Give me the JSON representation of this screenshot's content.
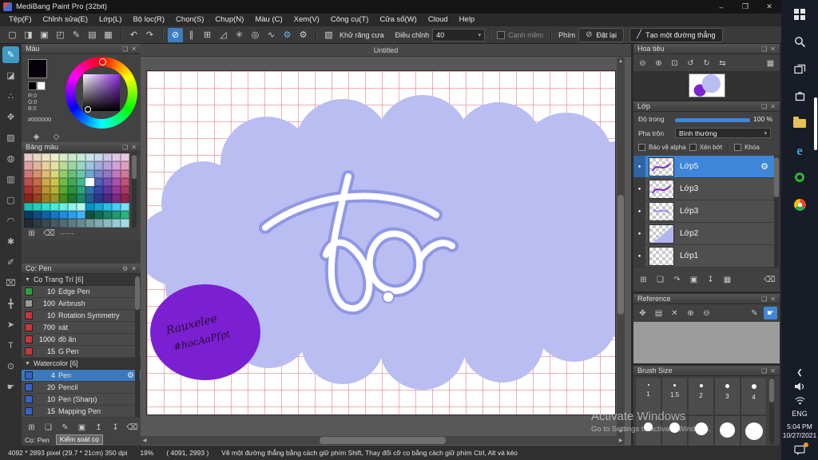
{
  "titlebar": {
    "title": "MediBang Paint Pro (32bit)",
    "minimize": "–",
    "maximize": "❐",
    "close": "✕"
  },
  "icons": {
    "float": "❏",
    "close": "✕",
    "caret": "▾",
    "group_arrow": "▼",
    "eye_dot": "●",
    "gear": "⚙",
    "scroll_up": "▲",
    "scroll_down": "▼",
    "scroll_left": "◀",
    "scroll_right": "▶",
    "chevron": "❮"
  },
  "menu": {
    "items": [
      "Tệp(F)",
      "Chỉnh sửa(E)",
      "Lớp(L)",
      "Bộ lọc(R)",
      "Chọn(S)",
      "Chụp(N)",
      "Màu (C)",
      "Xem(V)",
      "Công cụ(T)",
      "Cửa sổ(W)",
      "Cloud",
      "Help"
    ]
  },
  "toolbar": {
    "file_icons": [
      {
        "name": "new-canvas-icon",
        "glyph": "▢"
      },
      {
        "name": "open-file-icon",
        "glyph": "◨"
      },
      {
        "name": "save-icon",
        "glyph": "▣"
      },
      {
        "name": "comment-icon",
        "glyph": "◰"
      },
      {
        "name": "publish-icon",
        "glyph": "✎"
      },
      {
        "name": "pages-icon",
        "glyph": "▤"
      },
      {
        "name": "material-panel-icon",
        "glyph": "▦"
      }
    ],
    "history_icons": [
      {
        "name": "undo-icon",
        "glyph": "↶"
      },
      {
        "name": "redo-icon",
        "glyph": "↷"
      }
    ],
    "snap_icons": [
      {
        "name": "snap-off-icon",
        "glyph": "⊘",
        "active": true
      },
      {
        "name": "snap-parallel-icon",
        "glyph": "∥"
      },
      {
        "name": "snap-cross-icon",
        "glyph": "⊞"
      },
      {
        "name": "snap-vanishing-icon",
        "glyph": "◿"
      },
      {
        "name": "snap-radial-icon",
        "glyph": "✳"
      },
      {
        "name": "snap-ellipse-icon",
        "glyph": "◎"
      },
      {
        "name": "snap-curve-icon",
        "glyph": "∿"
      },
      {
        "name": "snap-settings-gear-icon",
        "glyph": "⚙",
        "accent": true
      },
      {
        "name": "settings-gear-icon",
        "glyph": "⚙"
      }
    ],
    "antialias_icon": "▧",
    "antialias_label": "Khử răng cưa",
    "adjust_label": "Điều chỉnh",
    "adjust_value": "40",
    "soft_label": "Cạnh mềm",
    "key_label": "Phím",
    "reset_icon": "⊘",
    "reset_label": "Đặt lại",
    "line_icon": "╱",
    "line_label": "Tạo một đường thẳng"
  },
  "toolstrip": {
    "tools": [
      {
        "name": "brush-tool",
        "glyph": "✎",
        "active": true
      },
      {
        "name": "eraser-tool",
        "glyph": "◪"
      },
      {
        "name": "dot-pen-tool",
        "glyph": "∴"
      },
      {
        "name": "move-tool",
        "glyph": "✥"
      },
      {
        "name": "fill-tool",
        "glyph": "▨"
      },
      {
        "name": "bucket-tool",
        "glyph": "◍"
      },
      {
        "name": "gradient-tool",
        "glyph": "▥"
      },
      {
        "name": "select-rect-tool",
        "glyph": "▢"
      },
      {
        "name": "lasso-tool",
        "glyph": "◠"
      },
      {
        "name": "magic-wand-tool",
        "glyph": "✱"
      },
      {
        "name": "select-pen-tool",
        "glyph": "✐"
      },
      {
        "name": "select-eraser-tool",
        "glyph": "⌧"
      },
      {
        "name": "divide-tool",
        "glyph": "╋"
      },
      {
        "name": "operation-tool",
        "glyph": "➤"
      },
      {
        "name": "text-tool",
        "glyph": "T"
      },
      {
        "name": "eyedropper-tool",
        "glyph": "⊙"
      },
      {
        "name": "hand-tool",
        "glyph": "☛"
      }
    ]
  },
  "color_panel": {
    "title": "Màu",
    "r": "R:0",
    "g": "G:0",
    "b": "B:0",
    "hex": "#000000",
    "dropper_icons": [
      {
        "name": "pick-color-icon",
        "glyph": "◈"
      },
      {
        "name": "add-to-palette-icon",
        "glyph": "◇"
      }
    ]
  },
  "palette_panel": {
    "title": "Bảng màu",
    "dashes": "-----",
    "selected": [
      3,
      7
    ],
    "footer_icons": [
      {
        "name": "add-color-icon",
        "glyph": "⊞"
      },
      {
        "name": "delete-color-icon",
        "glyph": "⌫"
      }
    ],
    "rows": [
      [
        "#e8c8c8",
        "#ecd6c6",
        "#f0e4c8",
        "#eef0cc",
        "#d8ecc6",
        "#c8e8cc",
        "#c6ead8",
        "#c8e6ea",
        "#c8d8ec",
        "#ccc8ec",
        "#e0c8ea",
        "#eac8dc"
      ],
      [
        "#dca0a0",
        "#e2b49a",
        "#e8d09e",
        "#e4e0a2",
        "#b8dc9a",
        "#9cd4a4",
        "#9ad8c4",
        "#9cc8e0",
        "#a0acde",
        "#b8a0dc",
        "#d4a0d8",
        "#e0a0bc"
      ],
      [
        "#cc7878",
        "#d49070",
        "#dcbc74",
        "#d8d478",
        "#94cc70",
        "#6cbc7c",
        "#6cc8a8",
        "#70a8d0",
        "#7884cc",
        "#9478c4",
        "#c078bc",
        "#d07898"
      ],
      [
        "#bc5050",
        "#c66c48",
        "#d0a84c",
        "#ccc450",
        "#70bc48",
        "#44a858",
        "#44b890",
        "#ffffff",
        "#5060bc",
        "#7850b4",
        "#ac50ac",
        "#c05078"
      ],
      [
        "#a83434",
        "#b25430",
        "#bc9434",
        "#b8b038",
        "#58a830",
        "#2c9440",
        "#2ca47c",
        "#3074ac",
        "#3848a8",
        "#60389c",
        "#983898",
        "#ac3864"
      ],
      [
        "#8c2222",
        "#964420",
        "#a07c24",
        "#9c9428",
        "#448c20",
        "#1c7830",
        "#1c8868",
        "#245c90",
        "#2c3890",
        "#4c2884",
        "#7c2880",
        "#902450"
      ],
      [
        "#18c0b0",
        "#20d0c0",
        "#30e0d0",
        "#48ecd8",
        "#68f0e0",
        "#90f4e8",
        "#b8f8f0",
        "#0890c8",
        "#18a8d8",
        "#28c0e8",
        "#48d0f0",
        "#78e0f8"
      ],
      [
        "#0a3a62",
        "#0e4e82",
        "#1262a2",
        "#1876c2",
        "#228ada",
        "#2e9eea",
        "#42b2f2",
        "#0e5242",
        "#126a52",
        "#1a8262",
        "#229a72",
        "#2ab282"
      ],
      [
        "#222a32",
        "#2e3a42",
        "#3a4a52",
        "#465a62",
        "#526a72",
        "#5e7a82",
        "#6a8a92",
        "#769aa2",
        "#82aab2",
        "#8ebac2",
        "#9acad2",
        "#a6dae2"
      ]
    ]
  },
  "brush_panel": {
    "title": "Cọ: Pen",
    "footer_label": "Cọ: Pen",
    "tooltip": "Kiểm soát cọ",
    "rows": [
      {
        "type": "group",
        "label": "Cọ Trang Trí [6]"
      },
      {
        "type": "brush",
        "size": "10",
        "name": "Edge Pen",
        "chip": "#2e9e40"
      },
      {
        "type": "brush",
        "size": "100",
        "name": "Airbrush",
        "chip": "#9a9a9a"
      },
      {
        "type": "brush",
        "size": "10",
        "name": "Rotation Symmetry",
        "chip": "#c23a3a"
      },
      {
        "type": "brush",
        "size": "700",
        "name": "xát",
        "chip": "#c23a3a"
      },
      {
        "type": "brush",
        "size": "1000",
        "name": "đồ ăn",
        "chip": "#c23a3a"
      },
      {
        "type": "brush",
        "size": "15",
        "name": "G Pen",
        "chip": "#c23a3a"
      },
      {
        "type": "group",
        "label": "Watercolor [6]"
      },
      {
        "type": "brush",
        "size": "4",
        "name": "Pen",
        "chip": "#3a62c8",
        "selected": true
      },
      {
        "type": "brush",
        "size": "20",
        "name": "Pencil",
        "chip": "#3a62c8"
      },
      {
        "type": "brush",
        "size": "10",
        "name": "Pen (Sharp)",
        "chip": "#3a62c8"
      },
      {
        "type": "brush",
        "size": "15",
        "name": "Mapping Pen",
        "chip": "#3a62c8"
      }
    ],
    "footer_icons": [
      {
        "name": "add-brush-icon",
        "glyph": "⊞"
      },
      {
        "name": "duplicate-brush-icon",
        "glyph": "❏"
      },
      {
        "name": "edit-brush-icon",
        "glyph": "✎"
      },
      {
        "name": "brush-folder-icon",
        "glyph": "▣"
      },
      {
        "name": "move-brush-up-icon",
        "glyph": "↥"
      },
      {
        "name": "move-brush-down-icon",
        "glyph": "↧"
      },
      {
        "name": "delete-brush-icon",
        "glyph": "⌫"
      }
    ]
  },
  "canvas": {
    "tab": "Untitled",
    "handwriting_line1": "Rauxelee",
    "handwriting_line2": "#hocAaPfpt"
  },
  "navigator": {
    "title": "Hoa tiêu",
    "icons": [
      {
        "name": "zoom-out-icon",
        "glyph": "⊖"
      },
      {
        "name": "zoom-in-icon",
        "glyph": "⊕"
      },
      {
        "name": "zoom-reset-icon",
        "glyph": "⊡"
      },
      {
        "name": "rotate-ccw-icon",
        "glyph": "↺"
      },
      {
        "name": "rotate-cw-icon",
        "glyph": "↻"
      },
      {
        "name": "flip-icon",
        "glyph": "⇆"
      },
      {
        "name": "display-grid-icon",
        "glyph": "▦",
        "right": true
      }
    ]
  },
  "layers": {
    "title": "Lớp",
    "opacity_label": "Độ trong",
    "opacity_value": "100 %",
    "blend_label": "Pha trộn",
    "blend_value": "Bình thường",
    "check_alpha": "Bảo vệ alpha",
    "check_clip": "Xén bớt",
    "check_lock": "Khóa",
    "items": [
      {
        "name": "Lớp5",
        "selected": true,
        "thumb": "scribble"
      },
      {
        "name": "Lớp3",
        "thumb": "scribble"
      },
      {
        "name": "Lớp3",
        "thumb": "scribble2"
      },
      {
        "name": "Lớp2",
        "thumb": "lavender"
      },
      {
        "name": "Lớp1",
        "thumb": "plain"
      }
    ],
    "footer_icons": [
      {
        "name": "add-layer-icon",
        "glyph": "⊞"
      },
      {
        "name": "duplicate-layer-icon",
        "glyph": "❏"
      },
      {
        "name": "transfer-layer-icon",
        "glyph": "↷"
      },
      {
        "name": "layer-folder-icon",
        "glyph": "▣"
      },
      {
        "name": "merge-layer-icon",
        "glyph": "↧"
      },
      {
        "name": "flatten-layer-icon",
        "glyph": "▦"
      },
      {
        "name": "delete-layer-icon",
        "glyph": "⌫",
        "right": true
      }
    ]
  },
  "reference": {
    "title": "Reference",
    "icons": [
      {
        "name": "move-icon",
        "glyph": "✥"
      },
      {
        "name": "load-image-icon",
        "glyph": "▤"
      },
      {
        "name": "clear-icon",
        "glyph": "✕"
      },
      {
        "name": "zoom-in-icon",
        "glyph": "⊕"
      },
      {
        "name": "zoom-out-icon",
        "glyph": "⊖"
      },
      {
        "name": "eyedropper-icon",
        "glyph": "✎",
        "right": true
      },
      {
        "name": "hand-icon",
        "glyph": "☛",
        "active": true
      }
    ]
  },
  "brush_size": {
    "title": "Brush Size",
    "rows": [
      [
        {
          "label": "1",
          "d": 2
        },
        {
          "label": "1.5",
          "d": 3
        },
        {
          "label": "2",
          "d": 4
        },
        {
          "label": "3",
          "d": 5
        },
        {
          "label": "4",
          "d": 6
        }
      ],
      [
        {
          "label": "",
          "d": 11
        },
        {
          "label": "",
          "d": 13
        },
        {
          "label": "",
          "d": 16
        },
        {
          "label": "",
          "d": 19
        },
        {
          "label": "",
          "d": 22
        }
      ]
    ]
  },
  "taskbar": {
    "lang": "ENG",
    "time": "5:04 PM",
    "date": "10/27/2021",
    "apps": [
      {
        "name": "start-button",
        "type": "windows"
      },
      {
        "name": "search-button",
        "type": "search"
      },
      {
        "name": "task-view-button",
        "type": "taskview"
      },
      {
        "name": "store-button",
        "type": "store"
      },
      {
        "name": "file-explorer-button",
        "type": "folder"
      },
      {
        "name": "edge-button",
        "type": "edge",
        "glyph": "e"
      },
      {
        "name": "green-app-button",
        "type": "greenapp"
      },
      {
        "name": "chrome-button",
        "type": "chrome"
      }
    ]
  },
  "statusbar": {
    "canvas_info": "4092 * 2893 pixel  (29.7 * 21cm)  350 dpi",
    "zoom": "19%",
    "cursor": "( 4091, 2993 )",
    "hint": "Vẽ một đường thẳng bằng cách giữ phím Shift, Thay đổi cỡ cọ bằng cách giữ phím Ctrl, Alt và kéo"
  },
  "watermark": {
    "line1": "Activate Windows",
    "line2": "Go to Settings to activate Windows."
  }
}
